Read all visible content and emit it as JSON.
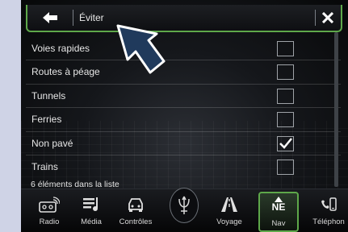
{
  "header": {
    "title": "Éviter",
    "back_icon": "back-arrow-icon",
    "close_icon": "close-icon"
  },
  "list": {
    "items": [
      {
        "label": "Voies rapides",
        "checked": false
      },
      {
        "label": "Routes à péage",
        "checked": false
      },
      {
        "label": "Tunnels",
        "checked": false
      },
      {
        "label": "Ferries",
        "checked": false
      },
      {
        "label": "Non pavé",
        "checked": true
      },
      {
        "label": "Trains",
        "checked": false
      }
    ],
    "count_text": "6 éléments dans la liste"
  },
  "dock": {
    "items": [
      {
        "label": "Radio",
        "icon": "radio-icon"
      },
      {
        "label": "Média",
        "icon": "media-icon"
      },
      {
        "label": "Contrôles",
        "icon": "car-controls-icon"
      },
      {
        "label": "Voyage",
        "icon": "road-icon"
      },
      {
        "label": "Nav",
        "icon": "compass-icon",
        "compass": "NE",
        "active": true
      },
      {
        "label": "Téléphon",
        "icon": "phone-icon"
      }
    ]
  },
  "colors": {
    "accent": "#5ea84a",
    "background": "#0e0f12",
    "pointer": "#1f3f66"
  }
}
